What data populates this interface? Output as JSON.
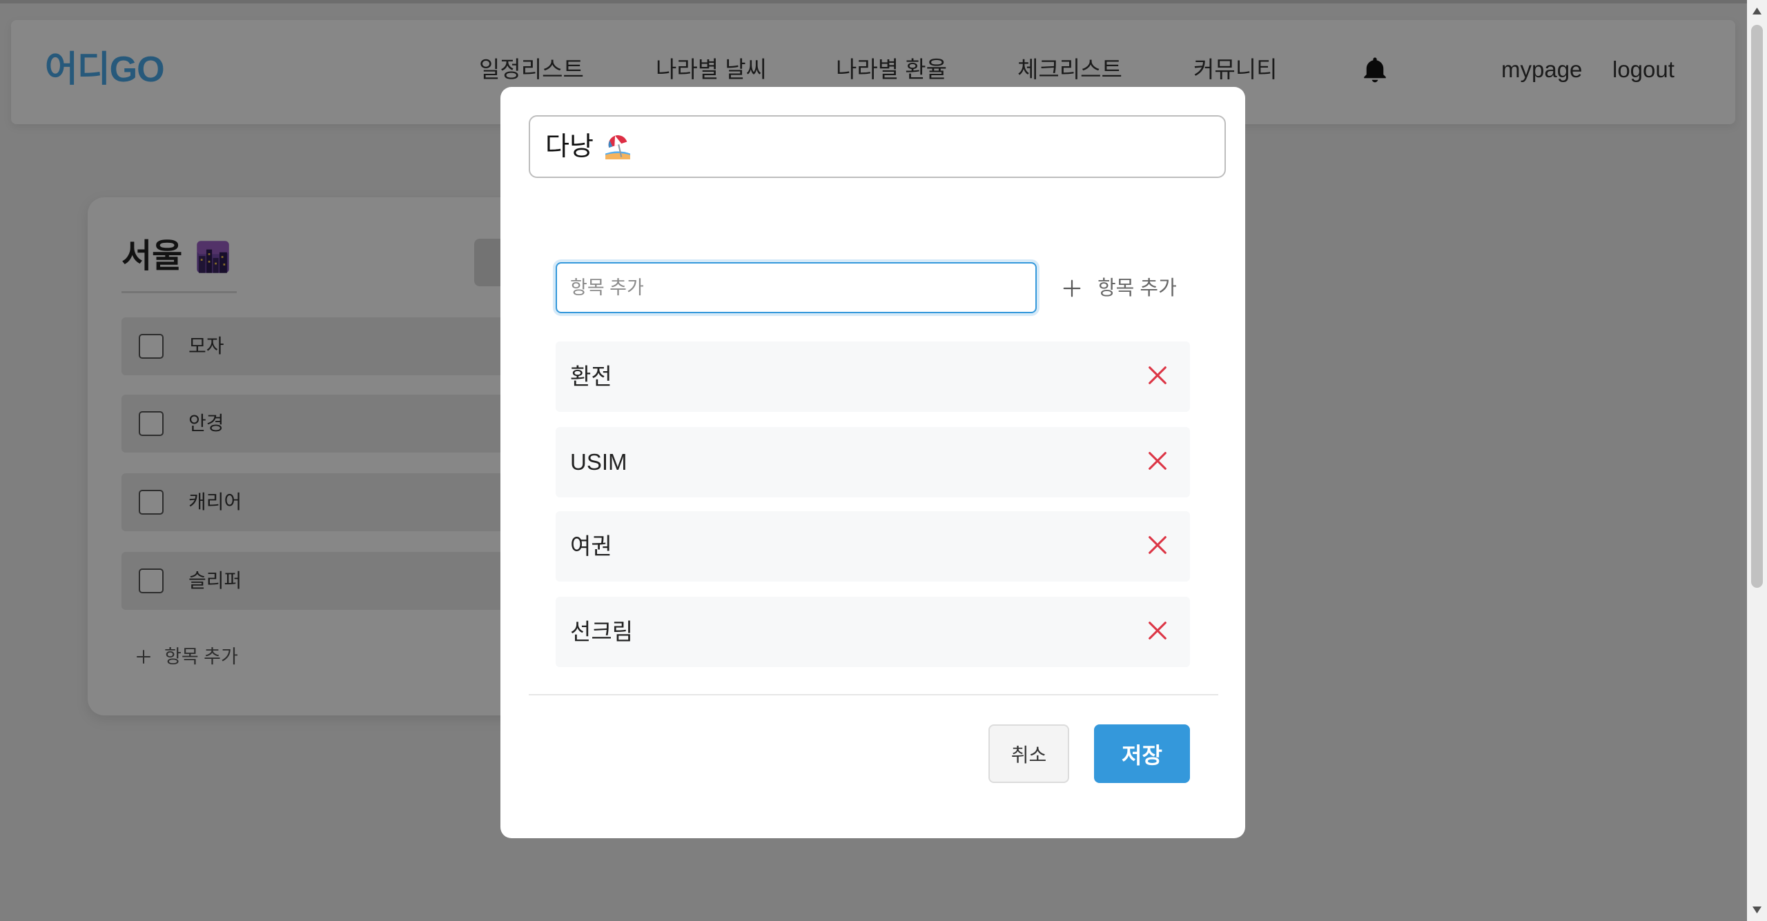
{
  "header": {
    "logo": "어디GO",
    "nav": [
      {
        "label": "일정리스트"
      },
      {
        "label": "나라별 날씨"
      },
      {
        "label": "나라별 환율"
      },
      {
        "label": "체크리스트"
      },
      {
        "label": "커뮤니티"
      }
    ],
    "notification_icon": "bell-icon",
    "mypage_label": "mypage",
    "logout_label": "logout"
  },
  "checklist_card": {
    "title": "서울",
    "title_icon": "cityscape-at-dusk-icon",
    "items": [
      {
        "label": "모자",
        "checked": false
      },
      {
        "label": "안경",
        "checked": false
      },
      {
        "label": "캐리어",
        "checked": false
      },
      {
        "label": "슬리퍼",
        "checked": false
      }
    ],
    "add_item_icon": "plus-icon",
    "add_item_label": "항목 추가"
  },
  "modal": {
    "title": "다낭",
    "title_icon": "beach-with-umbrella-icon",
    "add_input": {
      "placeholder": "항목 추가",
      "value": ""
    },
    "add_button_icon": "plus-icon",
    "add_button_label": "항목 추가",
    "items": [
      {
        "label": "환전"
      },
      {
        "label": "USIM"
      },
      {
        "label": "여권"
      },
      {
        "label": "선크림"
      }
    ],
    "delete_icon": "close-icon",
    "cancel_label": "취소",
    "save_label": "저장"
  },
  "colors": {
    "accent": "#3498db",
    "delete": "#dc3545",
    "backdrop": "rgba(0,0,0,0.47)"
  }
}
